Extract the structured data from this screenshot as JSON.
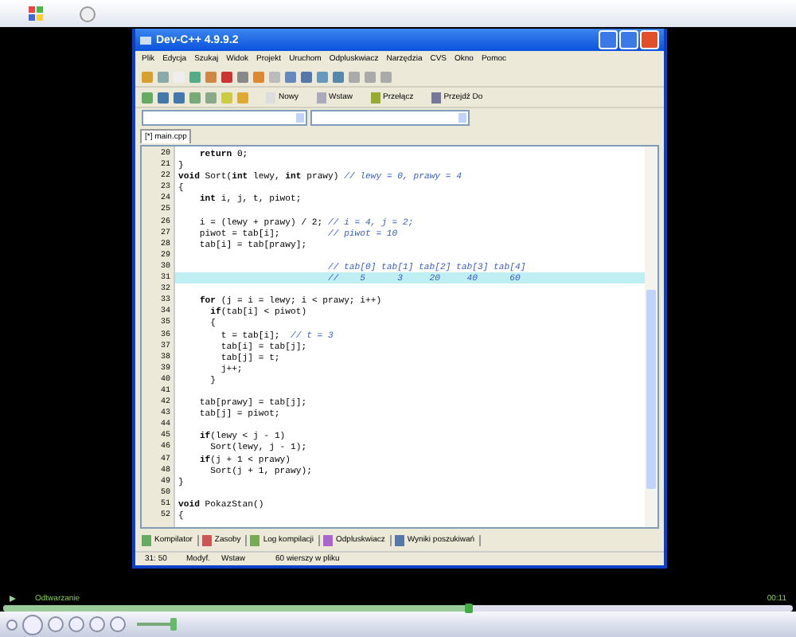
{
  "window": {
    "title": "Dev-C++ 4.9.9.2"
  },
  "menu": [
    "Plik",
    "Edycja",
    "Szukaj",
    "Widok",
    "Projekt",
    "Uruchom",
    "Odpluskwiacz",
    "Narzędzia",
    "CVS",
    "Okno",
    "Pomoc"
  ],
  "toolbar_buttons": [
    "Nowy",
    "Wstaw",
    "Przełącz",
    "Przejdź Do"
  ],
  "file_tabs": [
    {
      "label": "[*] main.cpp",
      "selected": true
    }
  ],
  "editor": {
    "lines": [
      {
        "number": "20",
        "code": "    **return** 0;",
        "highlighted": false
      },
      {
        "number": "21",
        "code": "}",
        "highlighted": false
      },
      {
        "number": "22",
        "code": "**void** Sort(**int** lewy, **int** prawy) ",
        "comment": "// lewy = 0, prawy = 4",
        "highlighted": false
      },
      {
        "number": "23",
        "code": "{",
        "highlighted": false
      },
      {
        "number": "24",
        "code": "    **int** i, j, t, piwot;",
        "highlighted": false
      },
      {
        "number": "25",
        "highlighted": false
      },
      {
        "number": "26",
        "code": "    i = (lewy + prawy) / 2; ",
        "comment": "// i = 4, j = 2;",
        "highlighted": false
      },
      {
        "number": "27",
        "code": "    piwot = tab[i];         ",
        "comment": "// piwot = 10",
        "highlighted": false
      },
      {
        "number": "28",
        "code": "    tab[i] = tab[prawy];",
        "highlighted": false
      },
      {
        "number": "29",
        "highlighted": false
      },
      {
        "number": "30",
        "comment": "                            // tab[0] tab[1] tab[2] tab[3] tab[4]",
        "highlighted": false
      },
      {
        "number": "31",
        "comment": "                            //    5      3     20     40      60",
        "highlighted": true
      },
      {
        "number": "32",
        "highlighted": false
      },
      {
        "number": "33",
        "code": "    **for** (j = i = lewy; i < prawy; i++)",
        "highlighted": false
      },
      {
        "number": "34",
        "code": "      **if**(tab[i] < piwot)",
        "highlighted": false
      },
      {
        "number": "35",
        "code": "      {",
        "highlighted": false
      },
      {
        "number": "36",
        "code": "        t = tab[i];  ",
        "comment": "// t = 3",
        "highlighted": false
      },
      {
        "number": "37",
        "code": "        tab[i] = tab[j];",
        "highlighted": false
      },
      {
        "number": "38",
        "code": "        tab[j] = t;",
        "highlighted": false
      },
      {
        "number": "39",
        "code": "        j++;",
        "highlighted": false
      },
      {
        "number": "40",
        "code": "      }",
        "highlighted": false
      },
      {
        "number": "41",
        "highlighted": false
      },
      {
        "number": "42",
        "code": "    tab[prawy] = tab[j];",
        "highlighted": false
      },
      {
        "number": "43",
        "code": "    tab[j] = piwot;",
        "highlighted": false
      },
      {
        "number": "44",
        "highlighted": false
      },
      {
        "number": "45",
        "code": "    **if**(lewy < j - 1)",
        "highlighted": false
      },
      {
        "number": "46",
        "code": "      Sort(lewy, j - 1);",
        "highlighted": false
      },
      {
        "number": "47",
        "code": "    **if**(j + 1 < prawy)",
        "highlighted": false
      },
      {
        "number": "48",
        "code": "      Sort(j + 1, prawy);",
        "highlighted": false
      },
      {
        "number": "49",
        "code": "}",
        "highlighted": false
      },
      {
        "number": "50",
        "highlighted": false
      },
      {
        "number": "51",
        "code": "**void** PokazStan()",
        "highlighted": false
      },
      {
        "number": "52",
        "code": "{",
        "highlighted": false
      }
    ]
  },
  "bottom_tabs": [
    "Kompilator",
    "Zasoby",
    "Log kompilacji",
    "Odpluskwiacz",
    "Wyniki poszukiwań"
  ],
  "status_bar": {
    "position": "31: 50",
    "modified": "Modyf.",
    "mode": "Wstaw",
    "line_count": "60 wierszy w pliku"
  },
  "player": {
    "status": "Odtwarzanie",
    "time": "00:11",
    "seek": {
      "level": 0.59
    },
    "volume": {
      "level": 0.95
    }
  }
}
